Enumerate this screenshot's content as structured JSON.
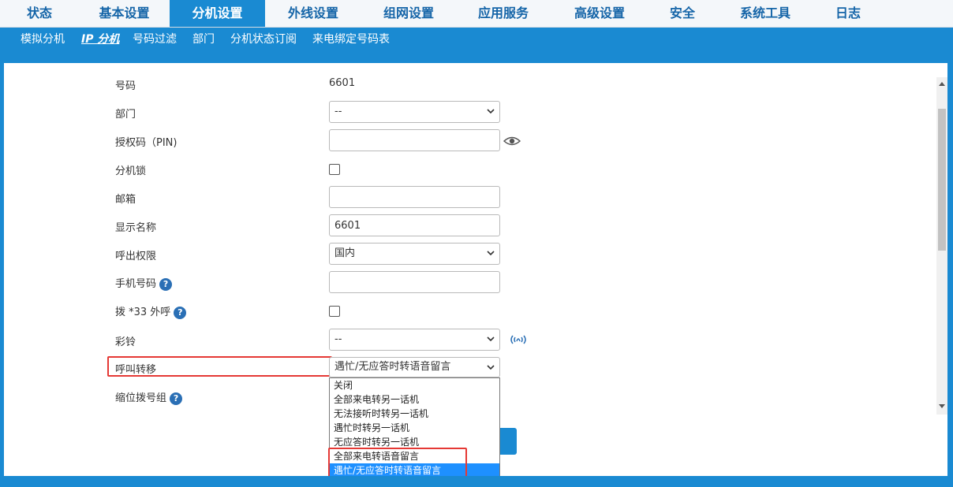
{
  "nav": {
    "tabs": [
      {
        "label": "状态"
      },
      {
        "label": "基本设置"
      },
      {
        "label": "分机设置"
      },
      {
        "label": "外线设置"
      },
      {
        "label": "组网设置"
      },
      {
        "label": "应用服务"
      },
      {
        "label": "高级设置"
      },
      {
        "label": "安全"
      },
      {
        "label": "系统工具"
      },
      {
        "label": "日志"
      }
    ],
    "active_tab": "分机设置",
    "subtabs": [
      {
        "label": "模拟分机"
      },
      {
        "label": "IP 分机"
      },
      {
        "label": "号码过滤"
      },
      {
        "label": "部门"
      },
      {
        "label": "分机状态订阅"
      },
      {
        "label": "来电绑定号码表"
      }
    ],
    "active_subtab": "IP 分机"
  },
  "form": {
    "number": {
      "label": "号码",
      "value": "6601"
    },
    "department": {
      "label": "部门",
      "value": "--"
    },
    "pin": {
      "label": "授权码（PIN)",
      "value": "",
      "icon": "eye-icon"
    },
    "ext_lock": {
      "label": "分机锁",
      "checked": false
    },
    "mailbox": {
      "label": "邮箱",
      "value": ""
    },
    "display_name": {
      "label": "显示名称",
      "value": "6601"
    },
    "outbound_permission": {
      "label": "呼出权限",
      "value": "国内"
    },
    "mobile": {
      "label": "手机号码",
      "value": "",
      "icon": "help-icon"
    },
    "dial33": {
      "label": "拨 *33 外呼",
      "checked": false,
      "icon": "help-icon"
    },
    "ringback": {
      "label": "彩铃",
      "value": "--",
      "icon": "audio-icon"
    },
    "call_forward": {
      "label": "呼叫转移",
      "value": "遇忙/无应答时转语音留言",
      "options": [
        "关闭",
        "全部来电转另一话机",
        "无法接听时转另一话机",
        "遇忙时转另一话机",
        "无应答时转另一话机",
        "全部来电转语音留言",
        "遇忙/无应答时转语音留言"
      ],
      "selected_index": 6
    },
    "abbr_dial_group": {
      "label": "缩位拨号组",
      "icon": "help-icon"
    }
  },
  "colors": {
    "accent": "#1a8ad2",
    "highlight": "#e53935",
    "selected_option": "#1e90ff"
  }
}
